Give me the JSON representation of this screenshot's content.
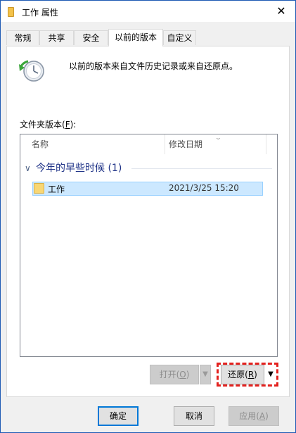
{
  "window": {
    "title": "工作 属性",
    "close_glyph": "✕"
  },
  "tabs": [
    {
      "label": "常规",
      "active": false
    },
    {
      "label": "共享",
      "active": false
    },
    {
      "label": "安全",
      "active": false
    },
    {
      "label": "以前的版本",
      "active": true
    },
    {
      "label": "自定义",
      "active": false
    }
  ],
  "panel": {
    "description": "以前的版本来自文件历史记录或来自还原点。",
    "folder_versions_label": "文件夹版本(",
    "folder_versions_key": "F",
    "folder_versions_suffix": "):"
  },
  "listview": {
    "columns": [
      "名称",
      "修改日期"
    ],
    "group": {
      "title": "今年的早些时候 (1)",
      "chevron": "∨"
    },
    "rows": [
      {
        "name": "工作",
        "modified": "2021/3/25 15:20",
        "selected": true
      }
    ]
  },
  "actions": {
    "open_label": "打开(",
    "open_key": "O",
    "open_suffix": ")",
    "restore_label": "还原(",
    "restore_key": "R",
    "restore_suffix": ")",
    "dropdown_glyph": "▼"
  },
  "footer": {
    "ok": "确定",
    "cancel": "取消",
    "apply_label": "应用(",
    "apply_key": "A",
    "apply_suffix": ")"
  },
  "icons": {
    "title_folder": "folder-icon",
    "history": "history-clock-icon",
    "row_folder": "folder-icon",
    "group_chevron": "chevron-down-icon",
    "sort": "sort-indicator-icon",
    "dropdown": "caret-down-icon",
    "close": "close-icon"
  },
  "colors": {
    "selection_bg": "#cce8ff",
    "selection_border": "#99d1ff",
    "group_text": "#1e3287",
    "highlight": "#e3211e",
    "default_button_border": "#0078d7"
  }
}
